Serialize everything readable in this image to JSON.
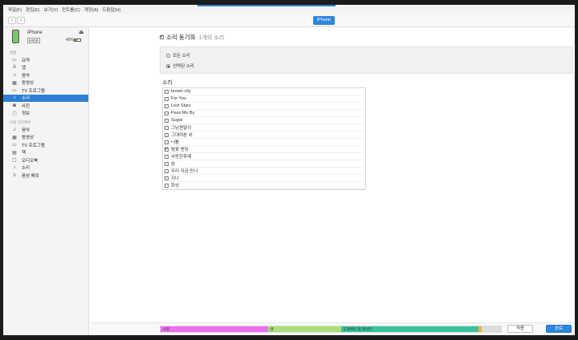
{
  "menu": [
    "파일(F)",
    "편집(E)",
    "보기(V)",
    "컨트롤(C)",
    "계정(A)",
    "도움말(H)"
  ],
  "toolbar": {
    "back": "‹",
    "forward": "›",
    "device_tab": "iPhone"
  },
  "device": {
    "name": "iPhone",
    "capacity": "64GB",
    "battery": "49%"
  },
  "sidebar": {
    "settings_label": "설정",
    "settings_items": [
      {
        "icon": "▭",
        "label": "요약"
      },
      {
        "icon": "A",
        "label": "앱"
      },
      {
        "icon": "♫",
        "label": "음악"
      },
      {
        "icon": "▦",
        "label": "동영상"
      },
      {
        "icon": "▭",
        "label": "TV 프로그램"
      },
      {
        "icon": "♪",
        "label": "소리"
      },
      {
        "icon": "◙",
        "label": "사진"
      },
      {
        "icon": "ⓘ",
        "label": "정보"
      }
    ],
    "ondevice_label": "나의 기기에서",
    "ondevice_items": [
      {
        "icon": "♫",
        "label": "음악"
      },
      {
        "icon": "▦",
        "label": "동영상"
      },
      {
        "icon": "▭",
        "label": "TV 프로그램"
      },
      {
        "icon": "▤",
        "label": "책"
      },
      {
        "icon": "▢",
        "label": "오디오북"
      },
      {
        "icon": "♪",
        "label": "소리"
      },
      {
        "icon": "≡",
        "label": "음성 메모"
      }
    ]
  },
  "sync": {
    "title": "소리 동기화",
    "count": "1개의 소리",
    "opt_all": "모든 소리",
    "opt_selected": "선택된 소리"
  },
  "ringtones": {
    "heading": "소리",
    "items": [
      {
        "label": "brown city",
        "checked": false
      },
      {
        "label": "For You",
        "checked": false
      },
      {
        "label": "Lost Stars",
        "checked": false
      },
      {
        "label": "Pass Me By",
        "checked": false
      },
      {
        "label": "Sugar",
        "checked": false
      },
      {
        "label": "그남편말이",
        "checked": false
      },
      {
        "label": "그대여본 위",
        "checked": false
      },
      {
        "label": "너를",
        "checked": false
      },
      {
        "label": "벚꽃 엔딩",
        "checked": true
      },
      {
        "label": "사랑한후에",
        "checked": false
      },
      {
        "label": "숨",
        "checked": false
      },
      {
        "label": "우리 지금 만나",
        "checked": false
      },
      {
        "label": "지나",
        "checked": false
      },
      {
        "label": "화성",
        "checked": false
      }
    ]
  },
  "storage": {
    "segments": [
      {
        "label": "사진",
        "color": "#ee6df0",
        "fraction": 0.315
      },
      {
        "label": "앱",
        "color": "#a8df7a",
        "fraction": 0.215
      },
      {
        "label": "도큐멘트 및 데이터",
        "color": "#37c29b",
        "fraction": 0.405
      },
      {
        "label": "",
        "color": "#f0b33a",
        "fraction": 0.008
      },
      {
        "label": "",
        "color": "#dcdcdc",
        "fraction": 0.057
      }
    ]
  },
  "buttons": {
    "apply": "적용",
    "done": "완료"
  }
}
